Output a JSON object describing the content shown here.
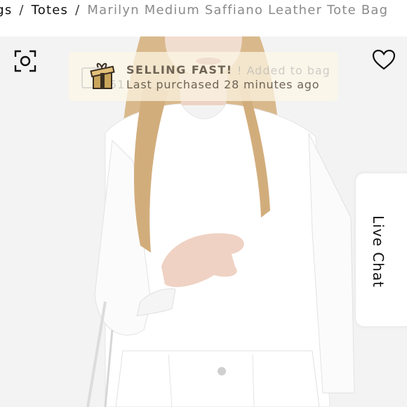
{
  "breadcrumb": {
    "items": [
      "ıgs",
      "Totes"
    ],
    "separator": "/",
    "current": "Marilyn Medium Saffiano Leather Tote Bag"
  },
  "icons": {
    "visual_search": "camera-scan-icon",
    "wishlist": "heart-icon",
    "gift": "gift-icon"
  },
  "toast": {
    "title": "SELLING FAST!",
    "subtitle": "Last purchased 28 minutes ago",
    "ghost_text_1": "! Added to bag",
    "ghost_text_2": "51"
  },
  "live_chat": {
    "label": "Live Chat"
  },
  "colors": {
    "toast_text": "#6f6354",
    "gift_gold": "#c9a55c",
    "background": "#f3f3f3"
  }
}
